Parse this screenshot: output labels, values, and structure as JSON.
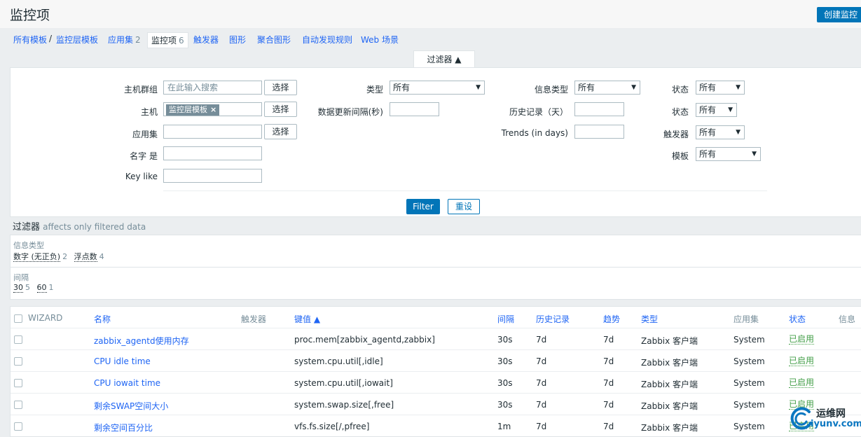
{
  "page": {
    "title": "监控项",
    "create_button": "创建监控"
  },
  "nav": {
    "all_templates": "所有模板",
    "separator": "/",
    "template": "监控层模板",
    "applications": {
      "label": "应用集",
      "count": "2"
    },
    "items": {
      "label": "监控项",
      "count": "6"
    },
    "triggers": "触发器",
    "graphs": "图形",
    "screens": "聚合图形",
    "discovery": "自动发现规则",
    "web": "Web 场景"
  },
  "filter": {
    "tab_label": "过滤器 ▲",
    "host_group_label": "主机群组",
    "host_group_placeholder": "在此输入搜索",
    "select_label": "选择",
    "host_label": "主机",
    "host_tag": "监控层模板",
    "host_tag_remove": "×",
    "app_label": "应用集",
    "name_label": "名字 是",
    "key_label": "Key like",
    "type_label": "类型",
    "type_value": "所有",
    "interval_label": "数据更新间隔(秒)",
    "info_type_label": "信息类型",
    "info_type_value": "所有",
    "history_label": "历史记录（天）",
    "trends_label": "Trends (in days)",
    "status1_label": "状态",
    "status1_value": "所有",
    "status2_label": "状态",
    "status2_value": "所有",
    "triggers_label": "触发器",
    "triggers_value": "所有",
    "template_label": "模板",
    "template_value": "所有",
    "arrow": "▼",
    "filter_button": "Filter",
    "reset_button": "重设"
  },
  "subfilter": {
    "title": "过滤器",
    "note": "affects only filtered data",
    "info_type": {
      "label": "信息类型",
      "values": [
        {
          "name": "数字 (无正负)",
          "count": "2"
        },
        {
          "name": "浮点数",
          "count": "4"
        }
      ]
    },
    "interval": {
      "label": "间隔",
      "values": [
        {
          "name": "30",
          "count": "5"
        },
        {
          "name": "60",
          "count": "1"
        }
      ]
    }
  },
  "table": {
    "headers": {
      "wizard": "WIZARD",
      "name": "名称",
      "triggers": "触发器",
      "key": "键值 ▲",
      "interval": "间隔",
      "history": "历史记录",
      "trends": "趋势",
      "type": "类型",
      "apps": "应用集",
      "status": "状态",
      "info": "信息"
    },
    "rows": [
      {
        "name": "zabbix_agentd使用内存",
        "key": "proc.mem[zabbix_agentd,zabbix]",
        "interval": "30s",
        "history": "7d",
        "trends": "7d",
        "type": "Zabbix 客户端",
        "app": "System",
        "status": "已启用"
      },
      {
        "name": "CPU idle time",
        "key": "system.cpu.util[,idle]",
        "interval": "30s",
        "history": "7d",
        "trends": "7d",
        "type": "Zabbix 客户端",
        "app": "System",
        "status": "已启用"
      },
      {
        "name": "CPU iowait time",
        "key": "system.cpu.util[,iowait]",
        "interval": "30s",
        "history": "7d",
        "trends": "7d",
        "type": "Zabbix 客户端",
        "app": "System",
        "status": "已启用"
      },
      {
        "name": "剩余SWAP空间大小",
        "key": "system.swap.size[,free]",
        "interval": "30s",
        "history": "7d",
        "trends": "7d",
        "type": "Zabbix 客户端",
        "app": "System",
        "status": "已启用"
      },
      {
        "name": "剩余空间百分比",
        "key": "vfs.fs.size[/,pfree]",
        "interval": "1m",
        "history": "7d",
        "trends": "7d",
        "type": "Zabbix 客户端",
        "app": "System",
        "status": "已启用"
      }
    ]
  },
  "watermark": {
    "line1": "运维网",
    "line2": "iyunv.com"
  }
}
